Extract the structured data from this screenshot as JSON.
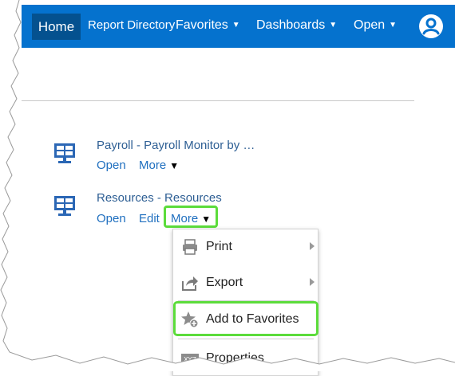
{
  "nav": {
    "home": "Home",
    "report_directory": "Report Directory",
    "favorites": "Favorites",
    "dashboards": "Dashboards",
    "open": "Open",
    "caret": "▼",
    "avatar_icon": "user-avatar-icon",
    "bar_color": "#0572ce",
    "home_color": "#04518f"
  },
  "items": [
    {
      "title": "Payroll - Payroll Monitor by …",
      "open": "Open",
      "more": "More",
      "more_arrow": "▼",
      "icon": "dashboard-monitor-icon"
    },
    {
      "title": "Resources - Resources",
      "open": "Open",
      "edit": "Edit",
      "more": "More",
      "more_arrow": "▼",
      "icon": "dashboard-monitor-icon"
    }
  ],
  "menu": {
    "items": [
      {
        "label": "Print",
        "icon": "print-icon",
        "has_submenu": true
      },
      {
        "label": "Export",
        "icon": "export-icon",
        "has_submenu": true
      },
      {
        "label": "Add to Favorites",
        "icon": "star-add-icon",
        "has_submenu": false
      },
      {
        "label": "Properties",
        "icon": "properties-xyz-icon",
        "has_submenu": false
      }
    ]
  },
  "highlight_color": "#5cdc3b"
}
